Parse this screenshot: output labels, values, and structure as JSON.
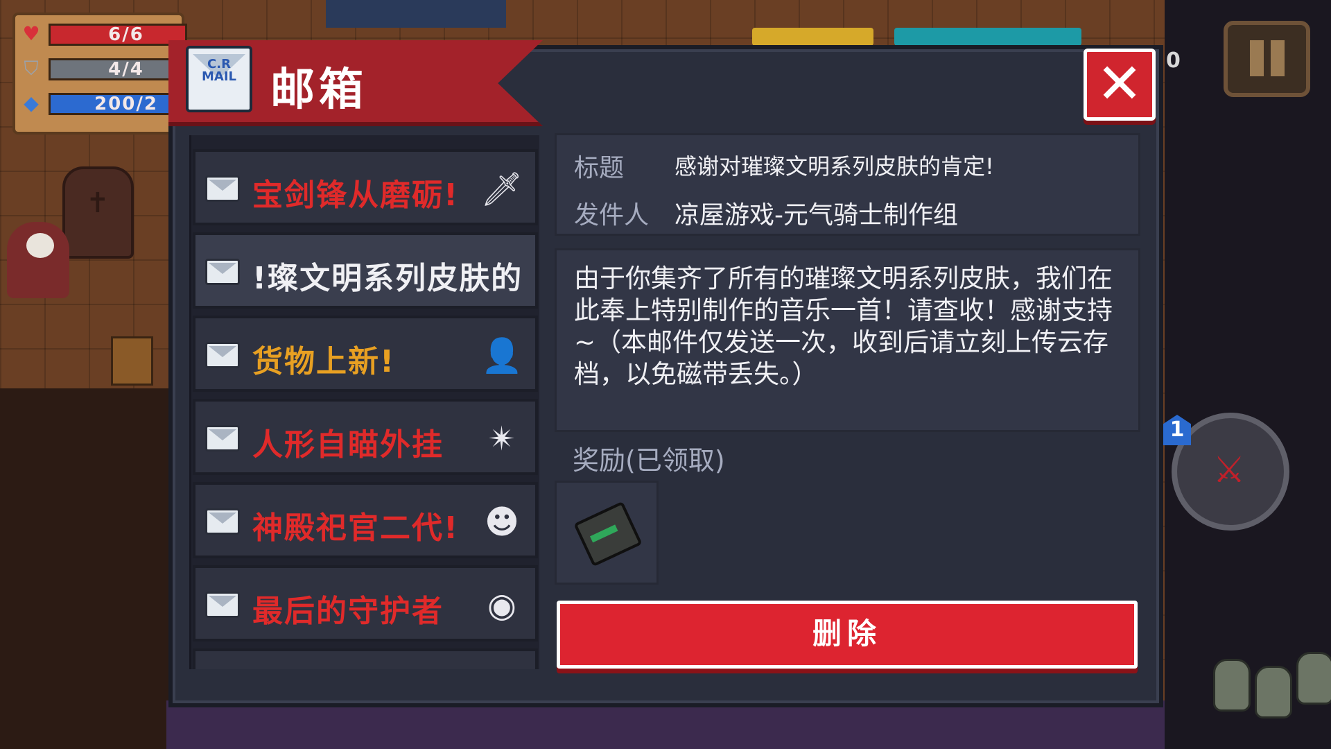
{
  "hud": {
    "health": "6/6",
    "armor": "4/4",
    "energy": "200/2",
    "coins": "0",
    "health_fraction": 1.0,
    "armor_fraction": 1.0,
    "energy_fraction": 1.0,
    "weapon_slot": "1"
  },
  "mailbox": {
    "header_icon_text": "C.R\nMAIL",
    "title": "邮箱",
    "close_symbol": "✕",
    "items": [
      {
        "label": "宝剑锋从磨砺!",
        "color": "#e02a2a",
        "thumb_icon": "sword-icon",
        "thumb": "🗡"
      },
      {
        "label": "!璨文明系列皮肤的",
        "color": "#f0f0f4",
        "thumb_icon": "",
        "thumb": ""
      },
      {
        "label": "货物上新!",
        "color": "#e8a022",
        "thumb_icon": "merchant-icon",
        "thumb": "👤"
      },
      {
        "label": "人形自瞄外挂",
        "color": "#e02a2a",
        "thumb_icon": "weapon-burst-icon",
        "thumb": "✴"
      },
      {
        "label": "神殿祀官二代!",
        "color": "#e02a2a",
        "thumb_icon": "priest-portrait-icon",
        "thumb": "☻"
      },
      {
        "label": "最后的守护者",
        "color": "#e02a2a",
        "thumb_icon": "guardian-orb-icon",
        "thumb": "◉"
      }
    ],
    "detail": {
      "title_label": "标题",
      "title_value": "感谢对璀璨文明系列皮肤的肯定!",
      "sender_label": "发件人",
      "sender_value": "凉屋游戏-元气骑士制作组",
      "body": "由于你集齐了所有的璀璨文明系列皮肤，我们在此奉上特别制作的音乐一首！请查收！感谢支持~（本邮件仅发送一次，收到后请立刻上传云存档，以免磁带丢失。）",
      "reward_label": "奖励(已领取)",
      "reward_icon": "cassette-tape-icon",
      "delete_label": "删除"
    }
  },
  "colors": {
    "header_red": "#a3222a",
    "close_red": "#d0252e",
    "delete_red": "#dd2430",
    "panel_bg": "#2a2e3c"
  }
}
